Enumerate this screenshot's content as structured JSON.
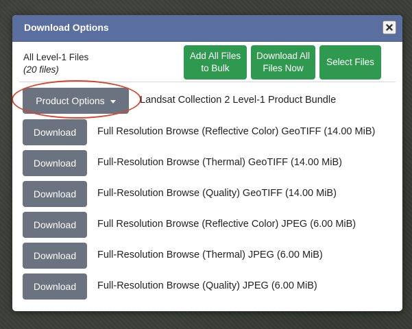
{
  "modal": {
    "title": "Download Options",
    "close_label": "close"
  },
  "bulk": {
    "label": "All Level-1 Files",
    "count": "(20 files)",
    "add_all_line1": "Add All Files",
    "add_all_line2": "to Bulk",
    "download_all_line1": "Download All",
    "download_all_line2": "Files Now",
    "select_files": "Select Files"
  },
  "product_options": {
    "label": "Product Options",
    "bundle": "Landsat Collection 2 Level-1 Product Bundle"
  },
  "downloads": [
    {
      "button": "Download",
      "label": "Full Resolution Browse (Reflective Color) GeoTIFF (14.00 MiB)"
    },
    {
      "button": "Download",
      "label": "Full-Resolution Browse (Thermal) GeoTIFF (14.00 MiB)"
    },
    {
      "button": "Download",
      "label": "Full-Resolution Browse (Quality) GeoTIFF (14.00 MiB)"
    },
    {
      "button": "Download",
      "label": "Full Resolution Browse (Reflective Color) JPEG (6.00 MiB)"
    },
    {
      "button": "Download",
      "label": "Full-Resolution Browse (Thermal) JPEG (6.00 MiB)"
    },
    {
      "button": "Download",
      "label": "Full-Resolution Browse (Quality) JPEG (6.00 MiB)"
    }
  ],
  "colors": {
    "header": "#5a6f9f",
    "green_button": "#2f9a4f",
    "gray_button": "#6b7280",
    "highlight": "#d9452b"
  },
  "icons": {
    "close": "close-icon",
    "dropdown": "caret-down-icon"
  }
}
